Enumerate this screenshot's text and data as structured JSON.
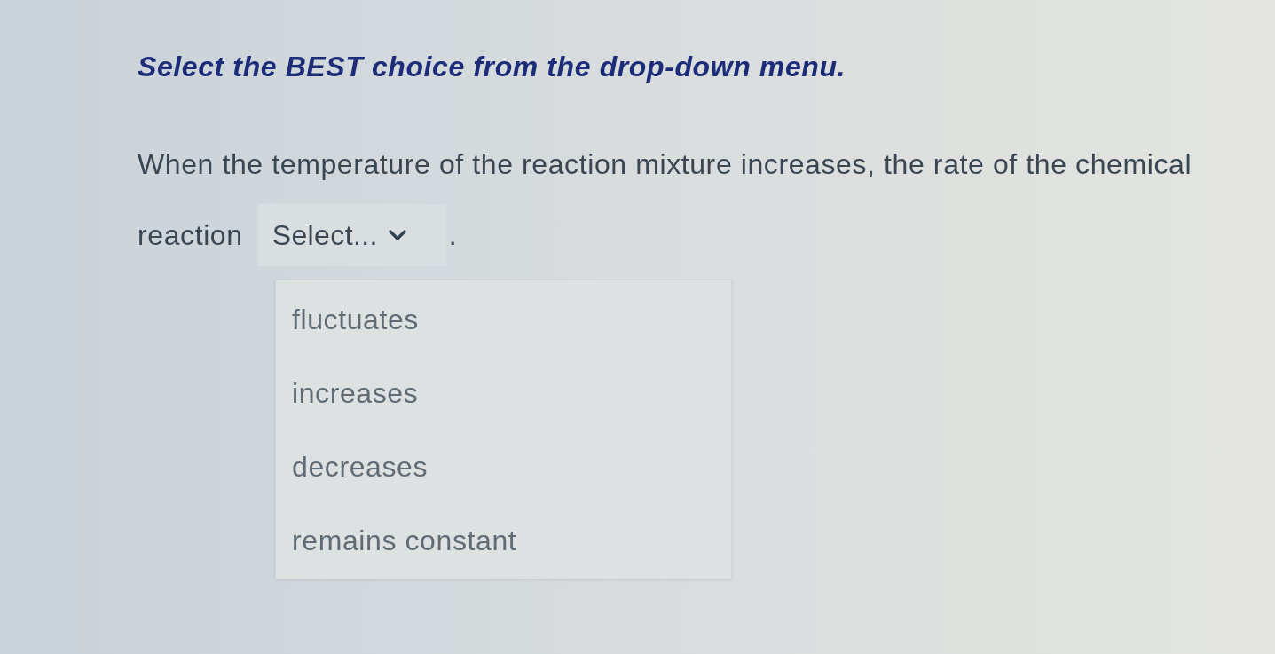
{
  "instruction": "Select the BEST choice from the drop-down menu.",
  "sentence": {
    "lines_before_blank": [
      "When the temperature of the reaction mixture increases, the rate of the chemical",
      "reaction"
    ],
    "after_blank": "."
  },
  "dropdown": {
    "placeholder": "Select...",
    "expanded": true,
    "options": [
      {
        "label": "fluctuates",
        "selected": false
      },
      {
        "label": "increases",
        "selected": false
      },
      {
        "label": "decreases",
        "selected": false
      },
      {
        "label": "remains constant",
        "selected": false
      }
    ]
  }
}
